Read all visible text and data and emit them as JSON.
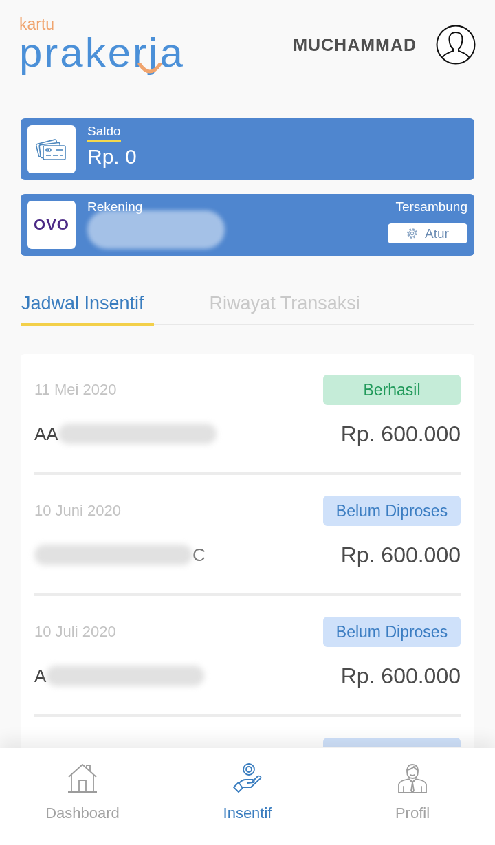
{
  "header": {
    "logo": {
      "small": "kartu",
      "main": "prakerja"
    },
    "user_name": "MUCHAMMAD"
  },
  "balance_card": {
    "label": "Saldo",
    "value": "Rp. 0"
  },
  "account_card": {
    "logo": "OVO",
    "label": "Rekening",
    "status": "Tersambung",
    "button": "Atur"
  },
  "tabs": [
    {
      "label": "Jadwal Insentif",
      "selected": true
    },
    {
      "label": "Riwayat Transaksi",
      "selected": false
    }
  ],
  "schedule": [
    {
      "kind": "full",
      "date": "11 Mei 2020",
      "status": {
        "kind": "success",
        "label": "Berhasil"
      },
      "ref_prefix": "AA",
      "amount": "Rp. 600.000"
    },
    {
      "kind": "full",
      "date": "10 Juni 2020",
      "status": {
        "kind": "pending",
        "label": "Belum Diproses"
      },
      "ref_suffix": "C",
      "amount": "Rp. 600.000"
    },
    {
      "kind": "full",
      "date": "10 Juli 2020",
      "status": {
        "kind": "pending",
        "label": "Belum Diproses"
      },
      "ref_prefix": "A",
      "amount": "Rp. 600.000"
    },
    {
      "kind": "partial",
      "status": {
        "kind": "pending"
      }
    }
  ],
  "bottom_nav": [
    {
      "label": "Dashboard",
      "selected": false
    },
    {
      "label": "Insentif",
      "selected": true
    },
    {
      "label": "Profil",
      "selected": false
    }
  ]
}
